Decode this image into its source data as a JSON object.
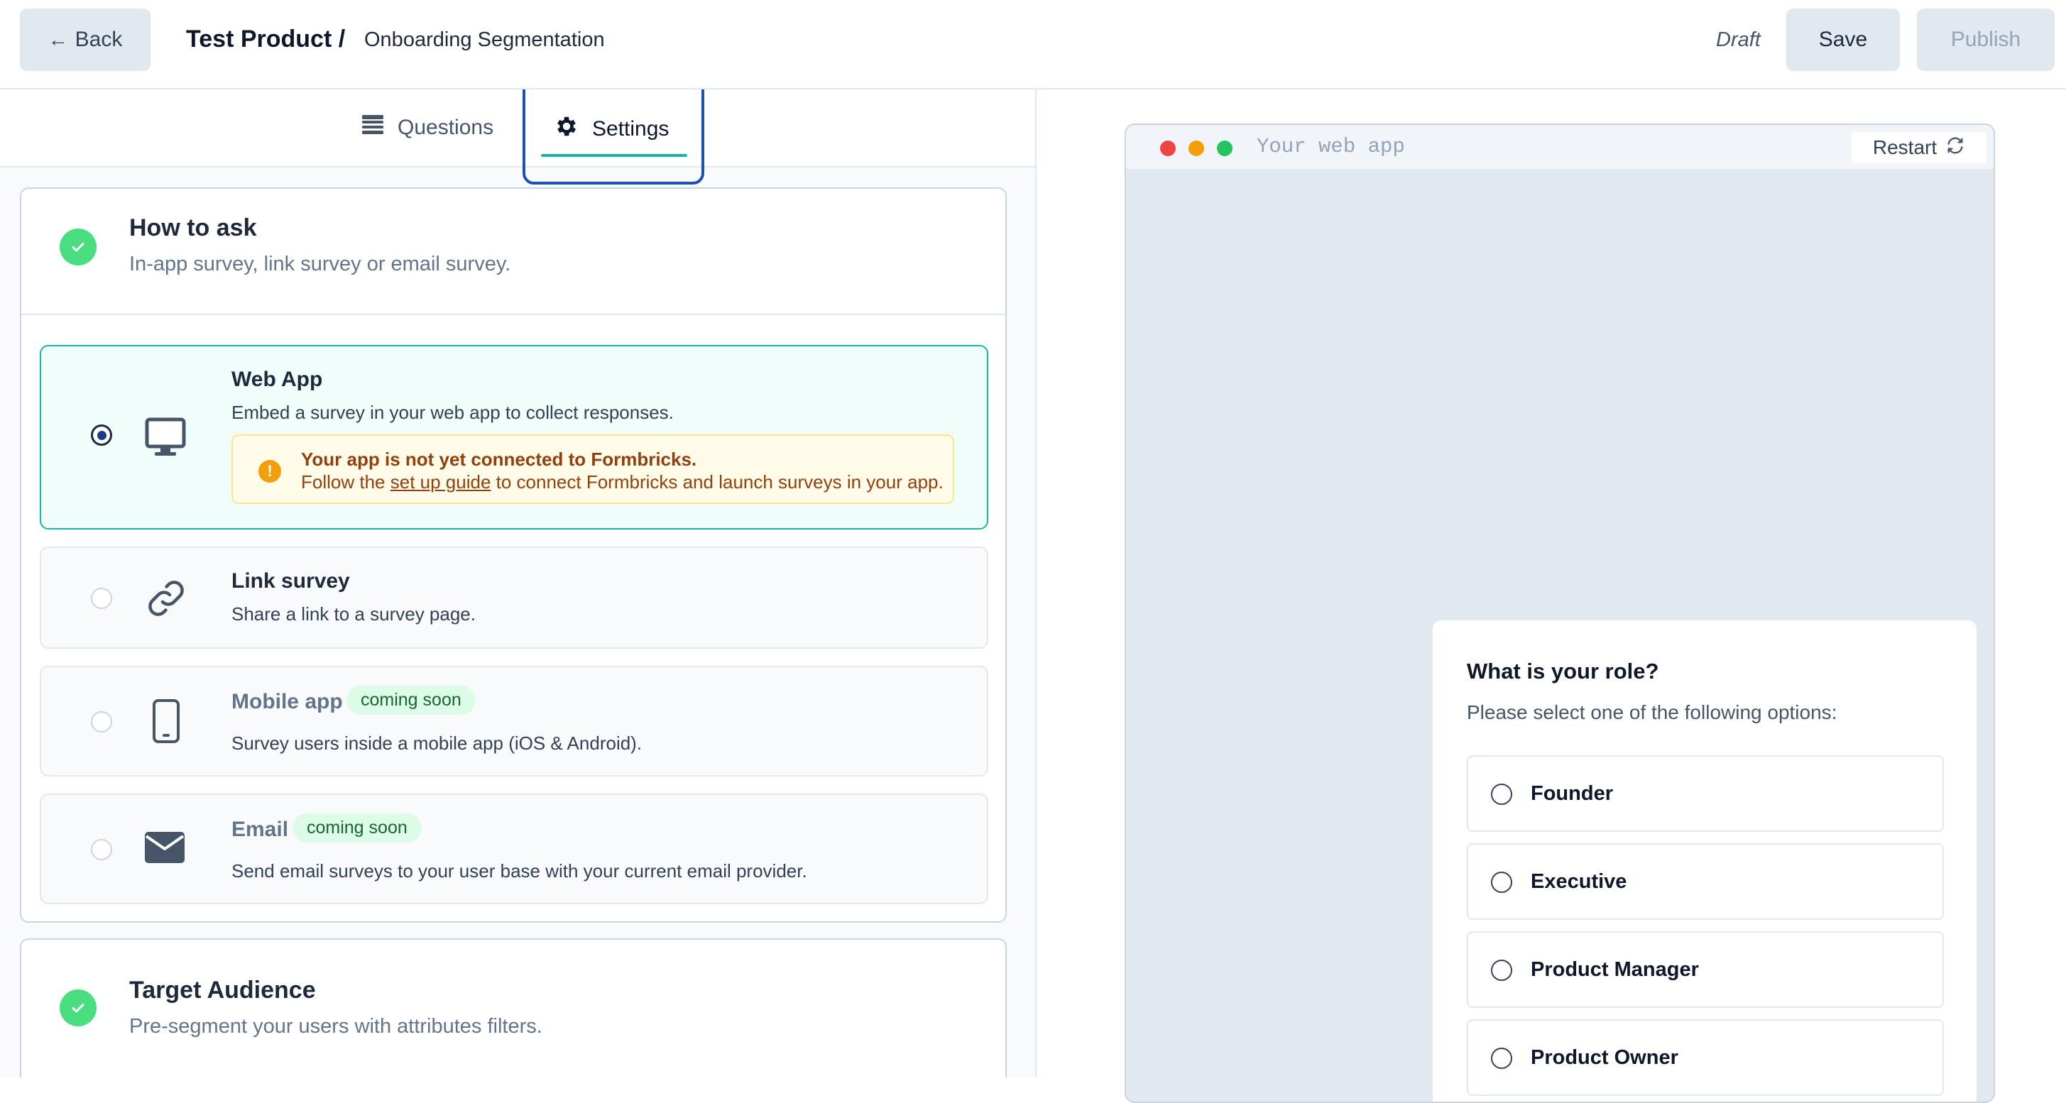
{
  "header": {
    "back_label": "Back",
    "product_name": "Test Product /",
    "survey_name": "Onboarding Segmentation",
    "status": "Draft",
    "save_label": "Save",
    "publish_label": "Publish"
  },
  "tabs": [
    {
      "label": "Questions",
      "icon": "list-icon",
      "active": false
    },
    {
      "label": "Settings",
      "icon": "gear-icon",
      "active": true
    }
  ],
  "how_to_ask": {
    "title": "How to ask",
    "subtitle": "In-app survey, link survey or email survey.",
    "options": [
      {
        "title": "Web App",
        "description": "Embed a survey in your web app to collect responses.",
        "icon": "monitor-icon",
        "selected": true,
        "warning": {
          "title": "Your app is not yet connected to Formbricks.",
          "prefix": "Follow the ",
          "link": "set up guide",
          "suffix": " to connect Formbricks and launch surveys in your app."
        }
      },
      {
        "title": "Link survey",
        "description": "Share a link to a survey page.",
        "icon": "link-icon",
        "selected": false
      },
      {
        "title": "Mobile app",
        "badge": "coming soon",
        "description": "Survey users inside a mobile app (iOS & Android).",
        "icon": "phone-icon",
        "selected": false
      },
      {
        "title": "Email",
        "badge": "coming soon",
        "description": "Send email surveys to your user base with your current email provider.",
        "icon": "mail-icon",
        "selected": false
      }
    ]
  },
  "target_audience": {
    "title": "Target Audience",
    "subtitle": "Pre-segment your users with attributes filters."
  },
  "preview": {
    "url": "Your web app",
    "restart_label": "Restart",
    "question": "What is your role?",
    "subheader": "Please select one of the following options:",
    "choices": [
      "Founder",
      "Executive",
      "Product Manager",
      "Product Owner"
    ]
  },
  "colors": {
    "accent": "#14b8a6",
    "success": "#4ade80",
    "warning": "#f59e0b",
    "focus_ring": "#1e50b4"
  }
}
